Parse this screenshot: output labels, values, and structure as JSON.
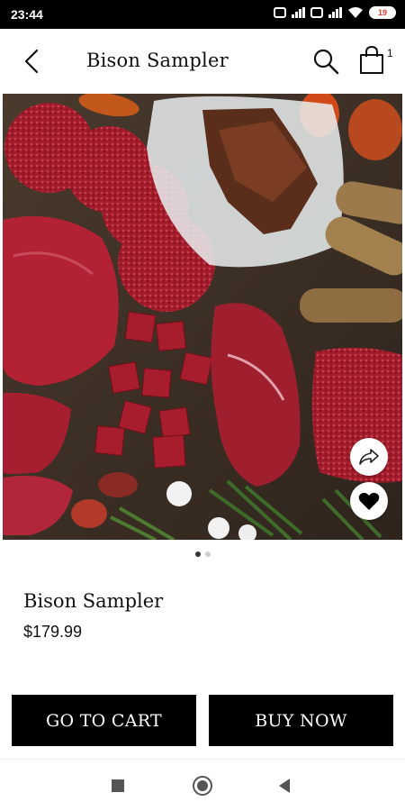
{
  "status_bar": {
    "time": "23:44",
    "battery": "19"
  },
  "header": {
    "title": "Bison Sampler",
    "cart_count": "1"
  },
  "product": {
    "name": "Bison Sampler",
    "price": "$179.99",
    "image_count": 2,
    "active_image": 1
  },
  "actions": {
    "go_to_cart": "GO TO CART",
    "buy_now": "BUY NOW"
  }
}
